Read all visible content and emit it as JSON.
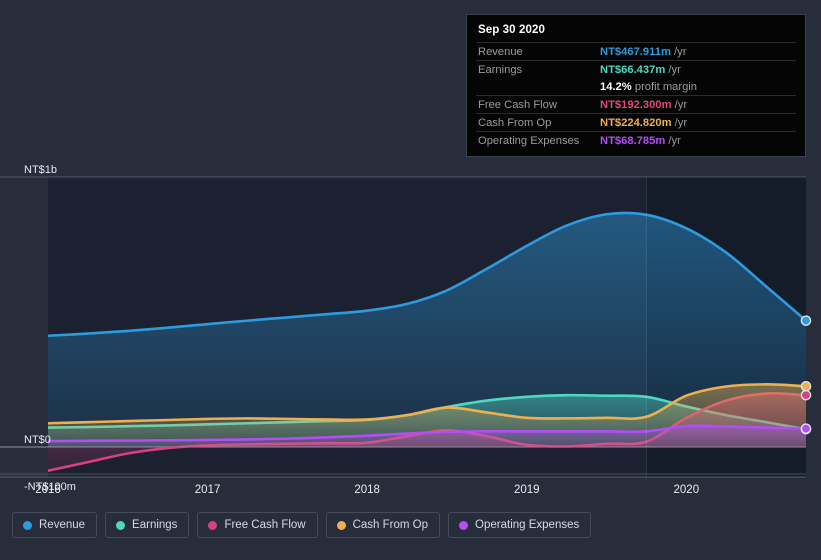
{
  "colors": {
    "page_bg": "#282d3c",
    "plot_bg": "#1b2130",
    "plot_bg_forecast": "#141b29",
    "revenue": "#2e9bdf",
    "earnings": "#4fd8c0",
    "free_cash_flow": "#d6417e",
    "cash_from_op": "#eeb04e",
    "operating_expenses": "#b14ef5",
    "gridline": "#8a8f9c",
    "tooltip_bg": "#050505",
    "tooltip_label": "#9b9b9b"
  },
  "tooltip": {
    "title": "Sep 30 2020",
    "rows": [
      {
        "label": "Revenue",
        "value": "NT$467.911m",
        "suffix": "/yr",
        "color": "#2e9bdf"
      },
      {
        "label": "Earnings",
        "value": "NT$66.437m",
        "suffix": "/yr",
        "color": "#4fd8c0"
      },
      {
        "label": "",
        "value": "14.2%",
        "suffix": "profit margin",
        "color": "#ffffff"
      },
      {
        "label": "Free Cash Flow",
        "value": "NT$192.300m",
        "suffix": "/yr",
        "color": "#e0487f"
      },
      {
        "label": "Cash From Op",
        "value": "NT$224.820m",
        "suffix": "/yr",
        "color": "#eeb04e"
      },
      {
        "label": "Operating Expenses",
        "value": "NT$68.785m",
        "suffix": "/yr",
        "color": "#b14ef5"
      }
    ]
  },
  "legend": {
    "items": [
      {
        "label": "Revenue",
        "color": "#2e9bdf"
      },
      {
        "label": "Earnings",
        "color": "#4fd8c0"
      },
      {
        "label": "Free Cash Flow",
        "color": "#d6417e"
      },
      {
        "label": "Cash From Op",
        "color": "#eeb04e"
      },
      {
        "label": "Operating Expenses",
        "color": "#b14ef5"
      }
    ]
  },
  "chart_data": {
    "type": "area",
    "title": "",
    "xlabel": "",
    "ylabel": "",
    "currency": "NT$",
    "grid": true,
    "legend_position": "bottom",
    "y_ticks": [
      {
        "label": "NT$1b",
        "value": 1000
      },
      {
        "label": "NT$0",
        "value": 0
      },
      {
        "label": "-NT$100m",
        "value": -100
      }
    ],
    "ylim": [
      -100,
      1100
    ],
    "x_ticks": [
      {
        "label": "2016",
        "value": 2016.0
      },
      {
        "label": "2017",
        "value": 2017.0
      },
      {
        "label": "2018",
        "value": 2018.0
      },
      {
        "label": "2019",
        "value": 2019.0
      },
      {
        "label": "2020",
        "value": 2020.0
      }
    ],
    "xlim": [
      2016.0,
      2020.75
    ],
    "forecast_start": 2019.75,
    "series": [
      {
        "name": "Revenue",
        "key": "revenue",
        "color": "#2e9bdf",
        "values": [
          {
            "x": 2016.0,
            "y": 412
          },
          {
            "x": 2016.25,
            "y": 420
          },
          {
            "x": 2016.5,
            "y": 430
          },
          {
            "x": 2016.75,
            "y": 442
          },
          {
            "x": 2017.0,
            "y": 455
          },
          {
            "x": 2017.25,
            "y": 468
          },
          {
            "x": 2017.5,
            "y": 480
          },
          {
            "x": 2017.75,
            "y": 492
          },
          {
            "x": 2018.0,
            "y": 505
          },
          {
            "x": 2018.25,
            "y": 530
          },
          {
            "x": 2018.5,
            "y": 580
          },
          {
            "x": 2018.75,
            "y": 660
          },
          {
            "x": 2019.0,
            "y": 745
          },
          {
            "x": 2019.25,
            "y": 820
          },
          {
            "x": 2019.5,
            "y": 862
          },
          {
            "x": 2019.75,
            "y": 860
          },
          {
            "x": 2020.0,
            "y": 810
          },
          {
            "x": 2020.25,
            "y": 720
          },
          {
            "x": 2020.5,
            "y": 595
          },
          {
            "x": 2020.75,
            "y": 468
          }
        ]
      },
      {
        "name": "Earnings",
        "key": "earnings",
        "color": "#4fd8c0",
        "values": [
          {
            "x": 2016.0,
            "y": 72
          },
          {
            "x": 2016.25,
            "y": 74
          },
          {
            "x": 2016.5,
            "y": 77
          },
          {
            "x": 2016.75,
            "y": 80
          },
          {
            "x": 2017.0,
            "y": 84
          },
          {
            "x": 2017.25,
            "y": 88
          },
          {
            "x": 2017.5,
            "y": 92
          },
          {
            "x": 2017.75,
            "y": 96
          },
          {
            "x": 2018.0,
            "y": 100
          },
          {
            "x": 2018.25,
            "y": 118
          },
          {
            "x": 2018.5,
            "y": 148
          },
          {
            "x": 2018.75,
            "y": 172
          },
          {
            "x": 2019.0,
            "y": 186
          },
          {
            "x": 2019.25,
            "y": 192
          },
          {
            "x": 2019.5,
            "y": 190
          },
          {
            "x": 2019.75,
            "y": 186
          },
          {
            "x": 2020.0,
            "y": 150
          },
          {
            "x": 2020.25,
            "y": 118
          },
          {
            "x": 2020.5,
            "y": 92
          },
          {
            "x": 2020.75,
            "y": 66
          }
        ]
      },
      {
        "name": "Free Cash Flow",
        "key": "free_cash_flow",
        "color": "#d6417e",
        "values": [
          {
            "x": 2016.0,
            "y": -88
          },
          {
            "x": 2016.25,
            "y": -56
          },
          {
            "x": 2016.5,
            "y": -24
          },
          {
            "x": 2016.75,
            "y": -4
          },
          {
            "x": 2017.0,
            "y": 6
          },
          {
            "x": 2017.25,
            "y": 10
          },
          {
            "x": 2017.5,
            "y": 12
          },
          {
            "x": 2017.75,
            "y": 14
          },
          {
            "x": 2018.0,
            "y": 16
          },
          {
            "x": 2018.25,
            "y": 40
          },
          {
            "x": 2018.5,
            "y": 62
          },
          {
            "x": 2018.75,
            "y": 40
          },
          {
            "x": 2019.0,
            "y": 8
          },
          {
            "x": 2019.25,
            "y": 2
          },
          {
            "x": 2019.5,
            "y": 12
          },
          {
            "x": 2019.75,
            "y": 20
          },
          {
            "x": 2020.0,
            "y": 108
          },
          {
            "x": 2020.25,
            "y": 172
          },
          {
            "x": 2020.5,
            "y": 198
          },
          {
            "x": 2020.75,
            "y": 192
          }
        ]
      },
      {
        "name": "Cash From Op",
        "key": "cash_from_op",
        "color": "#eeb04e",
        "values": [
          {
            "x": 2016.0,
            "y": 88
          },
          {
            "x": 2016.25,
            "y": 92
          },
          {
            "x": 2016.5,
            "y": 96
          },
          {
            "x": 2016.75,
            "y": 100
          },
          {
            "x": 2017.0,
            "y": 104
          },
          {
            "x": 2017.25,
            "y": 106
          },
          {
            "x": 2017.5,
            "y": 104
          },
          {
            "x": 2017.75,
            "y": 102
          },
          {
            "x": 2018.0,
            "y": 102
          },
          {
            "x": 2018.25,
            "y": 118
          },
          {
            "x": 2018.5,
            "y": 146
          },
          {
            "x": 2018.75,
            "y": 128
          },
          {
            "x": 2019.0,
            "y": 108
          },
          {
            "x": 2019.25,
            "y": 106
          },
          {
            "x": 2019.5,
            "y": 108
          },
          {
            "x": 2019.75,
            "y": 112
          },
          {
            "x": 2020.0,
            "y": 190
          },
          {
            "x": 2020.25,
            "y": 224
          },
          {
            "x": 2020.5,
            "y": 232
          },
          {
            "x": 2020.75,
            "y": 225
          }
        ]
      },
      {
        "name": "Operating Expenses",
        "key": "operating_expenses",
        "color": "#b14ef5",
        "values": [
          {
            "x": 2016.0,
            "y": 22
          },
          {
            "x": 2016.25,
            "y": 23
          },
          {
            "x": 2016.5,
            "y": 24
          },
          {
            "x": 2016.75,
            "y": 25
          },
          {
            "x": 2017.0,
            "y": 26
          },
          {
            "x": 2017.25,
            "y": 28
          },
          {
            "x": 2017.5,
            "y": 31
          },
          {
            "x": 2017.75,
            "y": 36
          },
          {
            "x": 2018.0,
            "y": 42
          },
          {
            "x": 2018.25,
            "y": 50
          },
          {
            "x": 2018.5,
            "y": 56
          },
          {
            "x": 2018.75,
            "y": 58
          },
          {
            "x": 2019.0,
            "y": 58
          },
          {
            "x": 2019.25,
            "y": 58
          },
          {
            "x": 2019.5,
            "y": 58
          },
          {
            "x": 2019.75,
            "y": 58
          },
          {
            "x": 2020.0,
            "y": 78
          },
          {
            "x": 2020.25,
            "y": 76
          },
          {
            "x": 2020.5,
            "y": 72
          },
          {
            "x": 2020.75,
            "y": 68
          }
        ]
      }
    ]
  }
}
